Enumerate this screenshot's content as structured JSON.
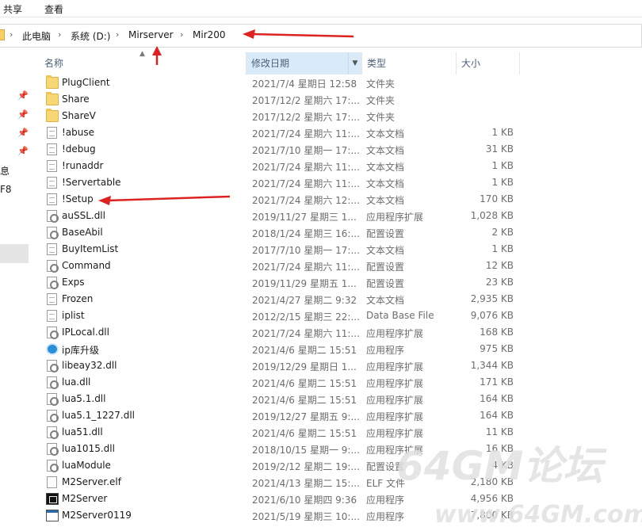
{
  "ribbon": {
    "tab_share": "共享",
    "tab_view": "查看"
  },
  "address": {
    "crumbs": [
      "此电脑",
      "系统 (D:)",
      "Mirserver",
      "Mir200"
    ],
    "separator": "›"
  },
  "columns": {
    "name": "名称",
    "date": "修改日期",
    "type": "类型",
    "size": "大小"
  },
  "nav_fragments": [
    "息",
    "F8"
  ],
  "files": [
    {
      "icon": "folder-icon",
      "name": "PlugClient",
      "date": "2021/7/4 星期日 12:58",
      "type": "文件夹",
      "size": ""
    },
    {
      "icon": "folder-icon",
      "name": "Share",
      "date": "2017/12/2 星期六 17:...",
      "type": "文件夹",
      "size": ""
    },
    {
      "icon": "folder-icon",
      "name": "ShareV",
      "date": "2017/12/2 星期六 17:...",
      "type": "文件夹",
      "size": ""
    },
    {
      "icon": "text-file-icon",
      "name": "!abuse",
      "date": "2021/7/24 星期六 11:...",
      "type": "文本文档",
      "size": "1 KB"
    },
    {
      "icon": "text-file-icon",
      "name": "!debug",
      "date": "2021/7/10 星期一 17:...",
      "type": "文本文档",
      "size": "31 KB"
    },
    {
      "icon": "text-file-icon",
      "name": "!runaddr",
      "date": "2021/7/24 星期六 11:...",
      "type": "文本文档",
      "size": "1 KB"
    },
    {
      "icon": "text-file-icon",
      "name": "!Servertable",
      "date": "2021/7/24 星期六 11:...",
      "type": "文本文档",
      "size": "1 KB"
    },
    {
      "icon": "text-file-icon",
      "name": "!Setup",
      "date": "2021/7/24 星期六 12:...",
      "type": "文本文档",
      "size": "170 KB"
    },
    {
      "icon": "gear-file-icon",
      "name": "auSSL.dll",
      "date": "2019/11/27 星期三 1...",
      "type": "应用程序扩展",
      "size": "1,028 KB"
    },
    {
      "icon": "gear-file-icon",
      "name": "BaseAbil",
      "date": "2018/1/24 星期三 16:...",
      "type": "配置设置",
      "size": "2 KB"
    },
    {
      "icon": "text-file-icon",
      "name": "BuyItemList",
      "date": "2017/7/10 星期一 17:...",
      "type": "文本文档",
      "size": "1 KB"
    },
    {
      "icon": "gear-file-icon",
      "name": "Command",
      "date": "2021/7/24 星期六 11:...",
      "type": "配置设置",
      "size": "12 KB"
    },
    {
      "icon": "gear-file-icon",
      "name": "Exps",
      "date": "2019/11/29 星期五 1...",
      "type": "配置设置",
      "size": "23 KB"
    },
    {
      "icon": "text-file-icon",
      "name": "Frozen",
      "date": "2021/4/27 星期二 9:32",
      "type": "文本文档",
      "size": "2,935 KB"
    },
    {
      "icon": "text-file-icon",
      "name": "iplist",
      "date": "2012/2/15 星期三 22:...",
      "type": "Data Base File",
      "size": "9,076 KB"
    },
    {
      "icon": "gear-file-icon",
      "name": "IPLocal.dll",
      "date": "2021/7/24 星期六 11:...",
      "type": "应用程序扩展",
      "size": "168 KB"
    },
    {
      "icon": "app-blue-icon",
      "name": "ip库升级",
      "date": "2021/4/6 星期二 15:51",
      "type": "应用程序",
      "size": "975 KB"
    },
    {
      "icon": "gear-file-icon",
      "name": "libeay32.dll",
      "date": "2019/12/29 星期日 1...",
      "type": "应用程序扩展",
      "size": "1,344 KB"
    },
    {
      "icon": "gear-file-icon",
      "name": "lua.dll",
      "date": "2021/4/6 星期二 15:51",
      "type": "应用程序扩展",
      "size": "171 KB"
    },
    {
      "icon": "gear-file-icon",
      "name": "lua5.1.dll",
      "date": "2021/4/6 星期二 15:51",
      "type": "应用程序扩展",
      "size": "164 KB"
    },
    {
      "icon": "gear-file-icon",
      "name": "lua5.1_1227.dll",
      "date": "2019/12/27 星期五 9:...",
      "type": "应用程序扩展",
      "size": "164 KB"
    },
    {
      "icon": "gear-file-icon",
      "name": "lua51.dll",
      "date": "2021/4/6 星期二 15:51",
      "type": "应用程序扩展",
      "size": "11 KB"
    },
    {
      "icon": "gear-file-icon",
      "name": "lua1015.dll",
      "date": "2018/10/15 星期一 9:...",
      "type": "应用程序扩展",
      "size": "16 KB"
    },
    {
      "icon": "gear-file-icon",
      "name": "luaModule",
      "date": "2019/2/12 星期二 19:...",
      "type": "配置设置",
      "size": "4 KB"
    },
    {
      "icon": "elf-file-icon",
      "name": "M2Server.elf",
      "date": "2021/4/13 星期二 15:...",
      "type": "ELF 文件",
      "size": "2,180 KB"
    },
    {
      "icon": "server-app-icon",
      "name": "M2Server",
      "date": "2021/6/10 星期四 9:36",
      "type": "应用程序",
      "size": "4,956 KB"
    },
    {
      "icon": "window-app-icon",
      "name": "M2Server0119",
      "date": "2021/5/19 星期三 10:...",
      "type": "应用程序",
      "size": "7,800 KB"
    }
  ],
  "watermark": {
    "brand": "64GM论坛",
    "url": "www.64GM.com"
  },
  "colors": {
    "arrow": "#dd2222",
    "header_sorted": "#d9ebf9",
    "header_text": "#4c607a",
    "meta_text": "#6d6d6d"
  }
}
